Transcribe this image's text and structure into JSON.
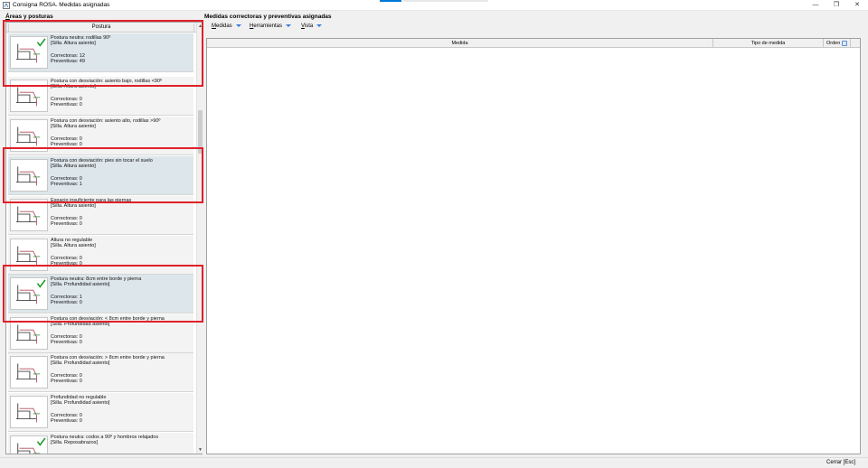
{
  "window": {
    "title": "Consigna ROSA. Medidas asignadas",
    "minimize_glyph": "—",
    "restore_glyph": "❐",
    "close_glyph": "✕"
  },
  "left": {
    "title_underlined": "Á",
    "title_rest": "reas y posturas",
    "column": "Postura",
    "items": [
      {
        "line1": "Postura neutra: rodillas 90º",
        "line2": "[Silla. Altura asiento]",
        "correctoras": "Correctoras: 12",
        "preventivas": "Preventivas: 49",
        "icon": "chair-knees-90-icon"
      },
      {
        "line1": "Postura con desviación: asiento bajo, rodillas <90º",
        "line2": "[Silla. Altura asiento]",
        "correctoras": "Correctoras: 0",
        "preventivas": "Preventivas: 0",
        "icon": "chair-seat-low-icon"
      },
      {
        "line1": "Postura con desviación: asiento alto, rodillas >90º",
        "line2": "[Silla. Altura asiento]",
        "correctoras": "Correctoras: 0",
        "preventivas": "Preventivas: 0",
        "icon": "chair-seat-high-icon"
      },
      {
        "line1": "Postura con desviación: pies sin tocar el suelo",
        "line2": "[Silla. Altura asiento]",
        "correctoras": "Correctoras: 0",
        "preventivas": "Preventivas: 1",
        "icon": "feet-off-floor-icon"
      },
      {
        "line1": "Espacio insuficiente para las piernas",
        "line2": "[Silla. Altura asiento]",
        "correctoras": "Correctoras: 0",
        "preventivas": "Preventivas: 0",
        "icon": "leg-space-icon"
      },
      {
        "line1": "Altura no regulable",
        "line2": "[Silla. Altura asiento]",
        "correctoras": "Correctoras: 0",
        "preventivas": "Preventivas: 0",
        "icon": "height-fixed-icon"
      },
      {
        "line1": "Postura neutra: 8cm entre borde y pierna",
        "line2": "[Silla. Profundidad asiento]",
        "correctoras": "Correctoras: 1",
        "preventivas": "Preventivas: 0",
        "icon": "seat-depth-neutral-icon"
      },
      {
        "line1": "Postura con desviación: < 8cm entre borde y pierna",
        "line2": "[Silla. Profundidad asiento]",
        "correctoras": "Correctoras: 0",
        "preventivas": "Preventivas: 0",
        "icon": "seat-depth-short-icon"
      },
      {
        "line1": "Postura con desviación: > 8cm entre borde y pierna",
        "line2": "[Silla. Profundidad asiento]",
        "correctoras": "Correctoras: 0",
        "preventivas": "Preventivas: 0",
        "icon": "seat-depth-long-icon"
      },
      {
        "line1": "Profundidad no regulable",
        "line2": "[Silla. Profundidad asiento]",
        "correctoras": "Correctoras: 0",
        "preventivas": "Preventivas: 0",
        "icon": "depth-fixed-icon"
      },
      {
        "line1": "Postura neutra: codos a 90º y hombros relajados",
        "line2": "[Silla. Reposabrazos]",
        "correctoras": "",
        "preventivas": "",
        "icon": "armrest-neutral-icon"
      }
    ]
  },
  "right": {
    "title": "Medidas correctoras y preventivas asignadas",
    "menus": [
      {
        "underlined": "M",
        "rest": "edidas"
      },
      {
        "underlined": "H",
        "rest": "erramientas"
      },
      {
        "underlined": "V",
        "rest": "ista"
      }
    ],
    "columns": {
      "medida": "Medida",
      "tipo": "Tipo de medida",
      "orden": "Orden"
    }
  },
  "footer": {
    "close": "Cerrar [Esc]"
  },
  "colors": {
    "highlight": "#e0202a",
    "selected_row": "#dde6ea",
    "check": "#1a9a2a",
    "menu_arrow": "#3b7dd8"
  }
}
